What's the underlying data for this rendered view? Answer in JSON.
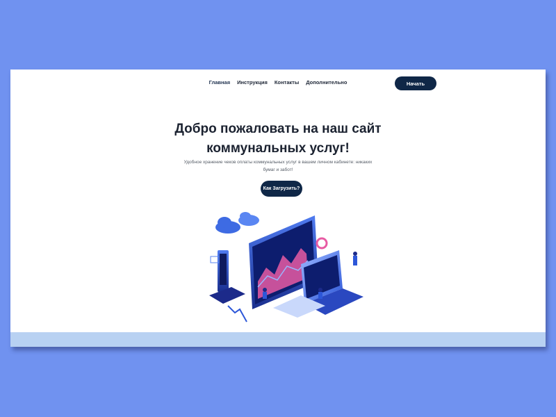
{
  "nav": {
    "items": [
      {
        "label": "Главная",
        "active": true
      },
      {
        "label": "Инструкция",
        "active": false
      },
      {
        "label": "Контакты",
        "active": false
      },
      {
        "label": "Дополнительно",
        "active": false
      }
    ],
    "start_label": "Начать"
  },
  "hero": {
    "title_line1": "Добро пожаловать на наш сайт",
    "title_line2": "коммунальных услуг!",
    "subtitle_line1": "Удобное хранение чеков оплаты коммунальных услуг в вашем личном кабинете: никаких",
    "subtitle_line2": "бумаг и забот!",
    "cta_label": "Как Загрузить?"
  },
  "colors": {
    "background": "#7092f0",
    "button": "#0f2747",
    "band": "#b8d1f2",
    "illustration_primary": "#2d57d8",
    "illustration_accent": "#e85aa3"
  }
}
